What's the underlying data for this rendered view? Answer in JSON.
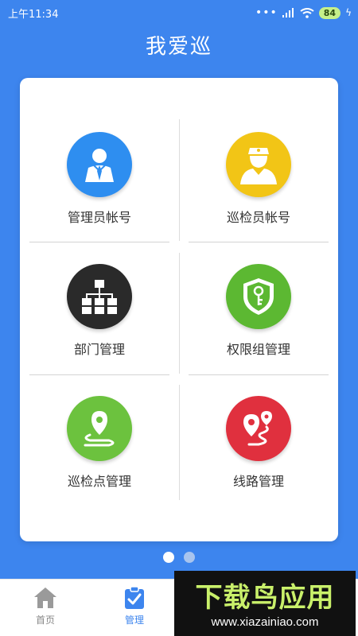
{
  "status": {
    "time": "上午11:34",
    "battery": "84"
  },
  "app": {
    "title": "我爱巡"
  },
  "tiles": [
    {
      "label": "管理员帐号",
      "icon": "admin-user-icon",
      "color": "#2e8ef0"
    },
    {
      "label": "巡检员帐号",
      "icon": "inspector-icon",
      "color": "#f2c516"
    },
    {
      "label": "部门管理",
      "icon": "org-chart-icon",
      "color": "#2a2a2a"
    },
    {
      "label": "权限组管理",
      "icon": "shield-key-icon",
      "color": "#5cb832"
    },
    {
      "label": "巡检点管理",
      "icon": "location-pin-icon",
      "color": "#6cc23e"
    },
    {
      "label": "线路管理",
      "icon": "route-icon",
      "color": "#e0303e"
    }
  ],
  "pager": {
    "count": 2,
    "active": 0,
    "active_color": "#ffffff",
    "inactive_color": "#a8c4ee"
  },
  "tabs": [
    {
      "label": "首页",
      "icon": "home-icon",
      "color": "#888888"
    },
    {
      "label": "管理",
      "icon": "clipboard-check-icon",
      "color": "#3d85ee"
    }
  ],
  "watermark": {
    "main": "下载鸟应用",
    "url": "www.xiazainiao.com"
  }
}
